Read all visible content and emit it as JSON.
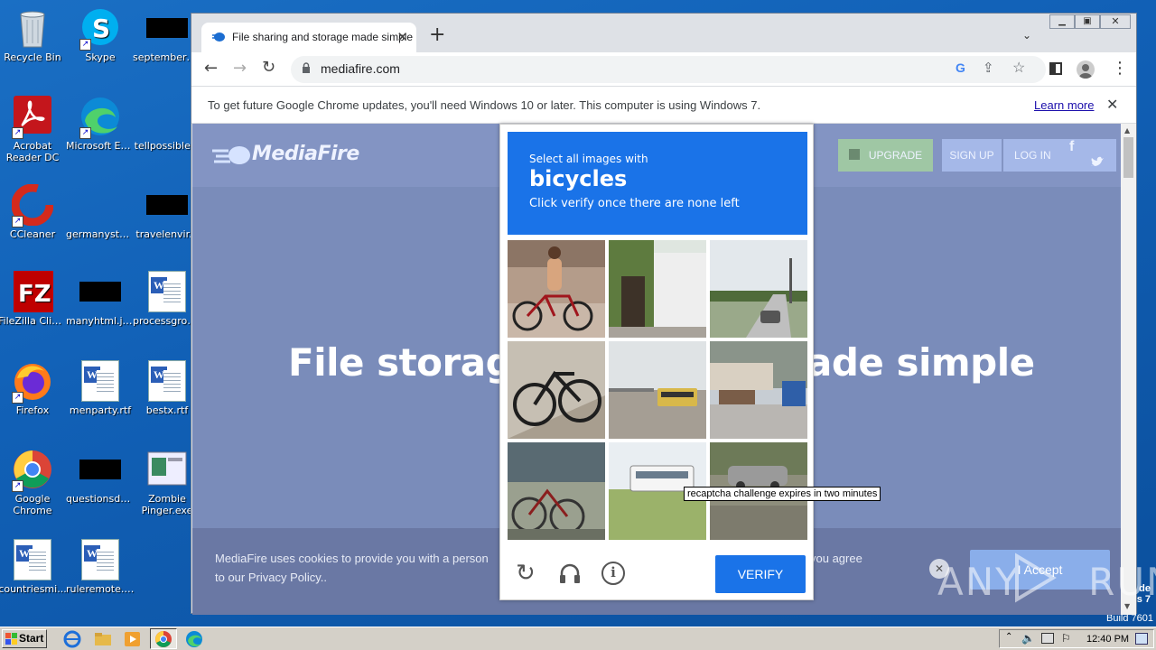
{
  "desktop": {
    "icons": [
      {
        "label": "Recycle Bin"
      },
      {
        "label": "Skype"
      },
      {
        "label": "septembero..."
      },
      {
        "label": "Acrobat Reader DC"
      },
      {
        "label": "Microsoft Edge"
      },
      {
        "label": "tellpossible..."
      },
      {
        "label": "CCleaner"
      },
      {
        "label": "germanystu..."
      },
      {
        "label": "travelenvir..."
      },
      {
        "label": "FileZilla Client"
      },
      {
        "label": "manyhtml.jpg"
      },
      {
        "label": "processgrou..."
      },
      {
        "label": "Firefox"
      },
      {
        "label": "menparty.rtf"
      },
      {
        "label": "bestx.rtf"
      },
      {
        "label": "Google Chrome"
      },
      {
        "label": "questionsda..."
      },
      {
        "label": "Zombie Pinger.exe"
      },
      {
        "label": "countriesmi..."
      },
      {
        "label": "ruleremote.rtf"
      }
    ],
    "watermark_lines": [
      "de",
      "s 7",
      "Build 7601"
    ]
  },
  "browser": {
    "tab_title": "File sharing and storage made simple",
    "url": "mediafire.com",
    "infobar_text": "To get future Google Chrome updates, you'll need Windows 10 or later. This computer is using Windows 7.",
    "infobar_link": "Learn more"
  },
  "page": {
    "logo": "MediaFire",
    "upgrade": "UPGRADE",
    "signup": "SIGN UP",
    "login": "LOG IN",
    "headline_left": "File storag",
    "headline_right": "ade simple",
    "cookie_line1": "MediaFire uses cookies to provide you with a person",
    "cookie_line1_right": "you agree",
    "cookie_line2": "to our Privacy Policy..",
    "accept": "I Accept"
  },
  "captcha": {
    "prompt": "Select all images with",
    "target": "bicycles",
    "instruction": "Click verify once there are none left",
    "verify": "VERIFY",
    "tooltip": "recaptcha challenge expires in two minutes"
  },
  "watermark": "ANY RUN",
  "taskbar": {
    "start": "Start",
    "clock": "12:40 PM"
  }
}
